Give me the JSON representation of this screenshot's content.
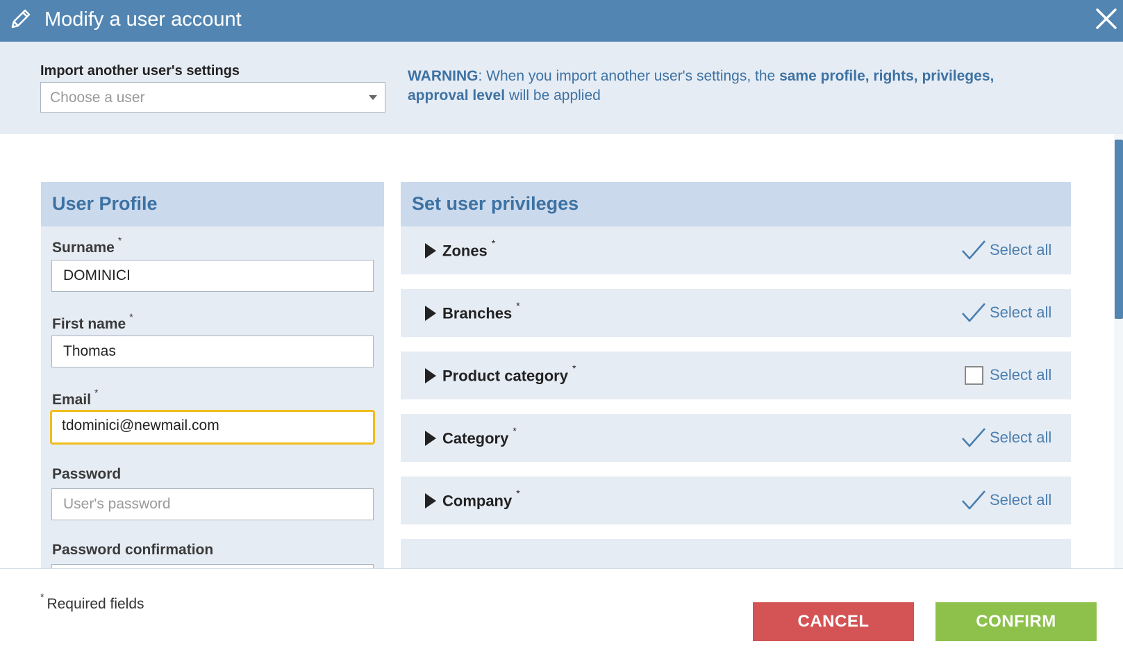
{
  "dialog": {
    "title": "Modify a user account",
    "close_icon": "close-icon",
    "edit_icon": "pencil-icon"
  },
  "import": {
    "label": "Import another user's settings",
    "placeholder": "Choose a user",
    "warning_prefix": "WARNING",
    "warning_text_1": ": When you import another user's settings, the ",
    "warning_bold": "same profile, rights, privileges, approval level",
    "warning_text_2": " will be applied"
  },
  "profile": {
    "title": "User Profile",
    "fields": [
      {
        "label": "Surname",
        "required": "*",
        "value": "DOMINICI",
        "placeholder": ""
      },
      {
        "label": "First name",
        "required": "*",
        "value": "Thomas",
        "placeholder": ""
      },
      {
        "label": "Email",
        "required": "*",
        "value": "tdominici@newmail.com",
        "placeholder": ""
      },
      {
        "label": "Password",
        "required": "",
        "value": "",
        "placeholder": "User's password"
      },
      {
        "label": "Password confirmation",
        "required": "",
        "value": "",
        "placeholder": ""
      }
    ]
  },
  "privileges": {
    "title": "Set user privileges",
    "select_all_label": "Select all",
    "rows": [
      {
        "name": "Zones",
        "required": "*",
        "state": "checked"
      },
      {
        "name": "Branches",
        "required": "*",
        "state": "checked"
      },
      {
        "name": "Product category",
        "required": "*",
        "state": "unchecked"
      },
      {
        "name": "Category",
        "required": "*",
        "state": "checked"
      },
      {
        "name": "Company",
        "required": "*",
        "state": "checked"
      }
    ]
  },
  "footer": {
    "required_mark": "*",
    "required_text": "Required fields",
    "cancel_label": "CANCEL",
    "confirm_label": "CONFIRM"
  },
  "colors": {
    "header": "#5285b1",
    "panel_bg": "#e6ecf4",
    "panel_header": "#cbd9ec",
    "accent_text": "#3d72a3",
    "focus_border": "#f0bc19",
    "cancel": "#d45354",
    "confirm": "#8dc14b"
  }
}
